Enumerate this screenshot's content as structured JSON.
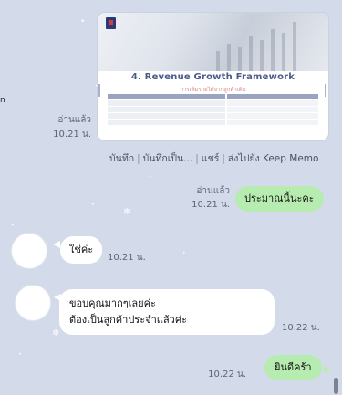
{
  "left_edge_mark": "n",
  "image_message": {
    "title": "4. Revenue Growth Framework",
    "subtitle": "การเพิ่มรายได้จากลูกค้าเดิม"
  },
  "image_receipt": {
    "read": "อ่านแล้ว",
    "time": "10.21 น."
  },
  "image_actions": {
    "save": "บันทึก",
    "save_as": "บันทึกเป็น...",
    "share": "แชร์",
    "keep": "ส่งไปยัง Keep Memo",
    "separator": "|"
  },
  "messages": [
    {
      "side": "me",
      "text": "ประมาณนี้นะคะ",
      "read": "อ่านแล้ว",
      "time": "10.21 น."
    },
    {
      "side": "them",
      "text": "ใช่ค่ะ",
      "time": "10.21 น."
    },
    {
      "side": "them",
      "lines": [
        "ขอบคุณมากๆเลยค่ะ",
        "ต้องเป็นลูกค้าประจำแล้วค่ะ"
      ],
      "time": "10.22 น."
    },
    {
      "side": "me",
      "text": "ยินดีคร้า",
      "time": "10.22 น."
    }
  ],
  "icons": [
    "snowflake-icon",
    "scrollbar-thumb"
  ],
  "colors": {
    "background": "#d3dae9",
    "my_bubble": "#b7ecb0",
    "their_bubble": "#ffffff",
    "meta_text": "#5e6473"
  }
}
